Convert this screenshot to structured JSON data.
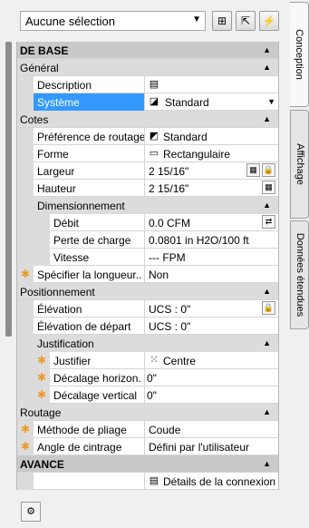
{
  "toolbar": {
    "selection_value": "Aucune sélection",
    "buttons": [
      "select-objects-icon",
      "quick-select-icon",
      "toggle-pickadd-icon"
    ]
  },
  "tabs": [
    {
      "label": "Conception",
      "active": true
    },
    {
      "label": "Affichage",
      "active": false
    },
    {
      "label": "Données étendues",
      "active": false
    }
  ],
  "sections": {
    "de_base": "DE BASE",
    "general": "Général",
    "cotes": "Cotes",
    "positionnement": "Positionnement",
    "routage": "Routage",
    "avance": "AVANCE"
  },
  "groups": {
    "dimensionnement": "Dimensionnement",
    "justification": "Justification"
  },
  "props": {
    "description": {
      "name": "Description",
      "value": ""
    },
    "systeme": {
      "name": "Système",
      "value": "Standard"
    },
    "preference_routage": {
      "name": "Préférence de routage",
      "value": "Standard"
    },
    "forme": {
      "name": "Forme",
      "value": "Rectangulaire"
    },
    "largeur": {
      "name": "Largeur",
      "value": "2 15/16\""
    },
    "hauteur": {
      "name": "Hauteur",
      "value": "2 15/16\""
    },
    "debit": {
      "name": "Débit",
      "value": "0.0 CFM"
    },
    "perte_charge": {
      "name": "Perte de charge",
      "value": "0.0801 in H2O/100 ft"
    },
    "vitesse": {
      "name": "Vitesse",
      "value": "--- FPM"
    },
    "specifier_longueur": {
      "name": "Spécifier la longueur...",
      "value": "Non"
    },
    "elevation": {
      "name": "Élévation",
      "value": "UCS : 0\""
    },
    "elevation_depart": {
      "name": "Élévation de départ",
      "value": "UCS : 0\""
    },
    "justifier": {
      "name": "Justifier",
      "value": "Centre"
    },
    "decalage_horizontal": {
      "name": "Décalage horizon...",
      "value": "0\""
    },
    "decalage_vertical": {
      "name": "Décalage vertical",
      "value": "0\""
    },
    "methode_pliage": {
      "name": "Méthode de pliage",
      "value": "Coude"
    },
    "angle_cintrage": {
      "name": "Angle de cintrage",
      "value": "Défini par l'utilisateur"
    },
    "details_connexion": {
      "name": "",
      "value": "Détails de la connexion"
    }
  }
}
